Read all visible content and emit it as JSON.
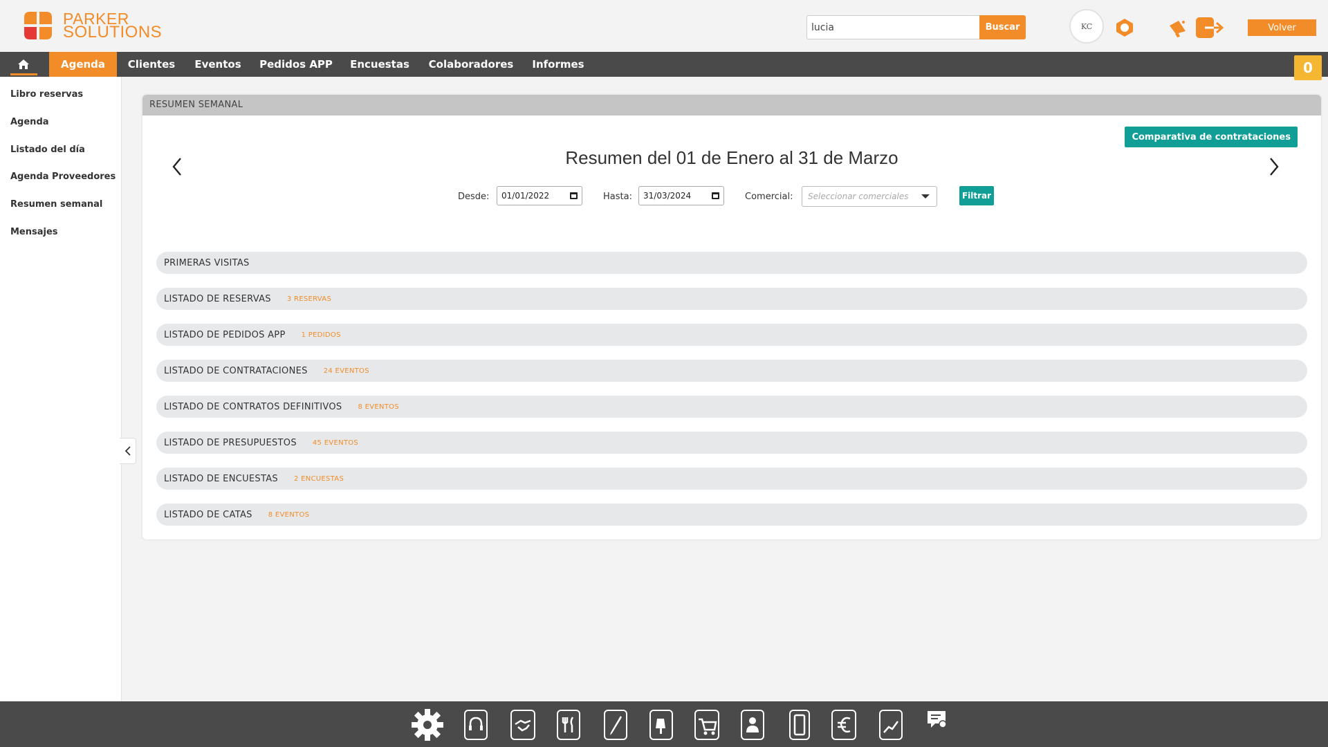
{
  "brand": {
    "line1": "PARKER",
    "line2": "SOLUTIONS",
    "mark_colors": [
      "#f28c28",
      "#e53935"
    ]
  },
  "search": {
    "value": "lucia",
    "button_label": "Buscar"
  },
  "avatar_text": "KC",
  "header_icons": [
    "hexagon-icon",
    "megaphone-icon",
    "logout-icon"
  ],
  "volver_label": "Volver",
  "topnav": {
    "home_icon": "home-icon",
    "items": [
      "Agenda",
      "Clientes",
      "Eventos",
      "Pedidos APP",
      "Encuestas",
      "Colaboradores",
      "Informes"
    ],
    "active": "Agenda"
  },
  "cart_count": "0",
  "sidebar": {
    "items": [
      "Libro reservas",
      "Agenda",
      "Listado del día",
      "Agenda Proveedores",
      "Resumen semanal",
      "Mensajes"
    ]
  },
  "panel": {
    "header": "RESUMEN SEMANAL",
    "comparativa_label": "Comparativa de contrataciones",
    "title": "Resumen del 01 de Enero al 31 de Marzo",
    "filters": {
      "desde_label": "Desde:",
      "desde_value": "01/01/2022",
      "hasta_label": "Hasta:",
      "hasta_value": "31/03/2024",
      "comercial_label": "Comercial:",
      "comercial_placeholder": "Seleccionar comerciales",
      "filtrar_label": "Filtrar"
    },
    "rows": [
      {
        "title": "PRIMERAS VISITAS",
        "count": ""
      },
      {
        "title": "LISTADO DE RESERVAS",
        "count": "3 RESERVAS"
      },
      {
        "title": "LISTADO DE PEDIDOS APP",
        "count": "1 PEDIDOS"
      },
      {
        "title": "LISTADO DE CONTRATACIONES",
        "count": "24 EVENTOS"
      },
      {
        "title": "LISTADO DE CONTRATOS DEFINITIVOS",
        "count": "8 EVENTOS"
      },
      {
        "title": "LISTADO DE PRESUPUESTOS",
        "count": "45 EVENTOS"
      },
      {
        "title": "LISTADO DE ENCUESTAS",
        "count": "2 ENCUESTAS"
      },
      {
        "title": "LISTADO DE CATAS",
        "count": "8 EVENTOS"
      }
    ]
  },
  "bottombar": {
    "icons": [
      "settings-icon",
      "headset-icon",
      "handshake-icon",
      "restaurant-icon",
      "pen-icon",
      "hand-bell-icon",
      "cart-icon",
      "contacts-icon",
      "mobile-icon",
      "euro-icon",
      "chart-icon",
      "chat-user-icon"
    ]
  },
  "colors": {
    "accent": "#f28c28",
    "teal": "#119e96",
    "nav_bg": "#4a4a4a",
    "counter": "#f5b731"
  }
}
